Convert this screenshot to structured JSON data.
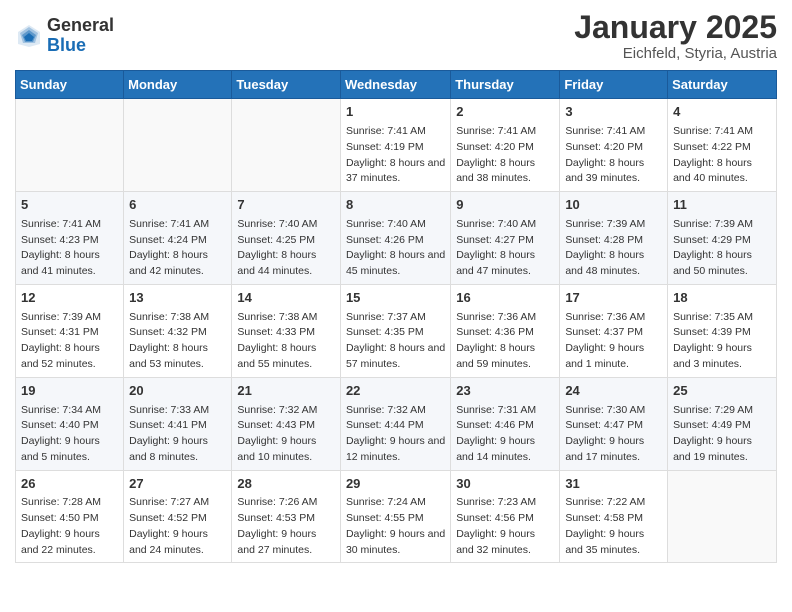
{
  "header": {
    "logo_line1": "General",
    "logo_line2": "Blue",
    "title": "January 2025",
    "location": "Eichfeld, Styria, Austria"
  },
  "weekdays": [
    "Sunday",
    "Monday",
    "Tuesday",
    "Wednesday",
    "Thursday",
    "Friday",
    "Saturday"
  ],
  "weeks": [
    [
      {
        "day": "",
        "content": ""
      },
      {
        "day": "",
        "content": ""
      },
      {
        "day": "",
        "content": ""
      },
      {
        "day": "1",
        "content": "Sunrise: 7:41 AM\nSunset: 4:19 PM\nDaylight: 8 hours and 37 minutes."
      },
      {
        "day": "2",
        "content": "Sunrise: 7:41 AM\nSunset: 4:20 PM\nDaylight: 8 hours and 38 minutes."
      },
      {
        "day": "3",
        "content": "Sunrise: 7:41 AM\nSunset: 4:20 PM\nDaylight: 8 hours and 39 minutes."
      },
      {
        "day": "4",
        "content": "Sunrise: 7:41 AM\nSunset: 4:22 PM\nDaylight: 8 hours and 40 minutes."
      }
    ],
    [
      {
        "day": "5",
        "content": "Sunrise: 7:41 AM\nSunset: 4:23 PM\nDaylight: 8 hours and 41 minutes."
      },
      {
        "day": "6",
        "content": "Sunrise: 7:41 AM\nSunset: 4:24 PM\nDaylight: 8 hours and 42 minutes."
      },
      {
        "day": "7",
        "content": "Sunrise: 7:40 AM\nSunset: 4:25 PM\nDaylight: 8 hours and 44 minutes."
      },
      {
        "day": "8",
        "content": "Sunrise: 7:40 AM\nSunset: 4:26 PM\nDaylight: 8 hours and 45 minutes."
      },
      {
        "day": "9",
        "content": "Sunrise: 7:40 AM\nSunset: 4:27 PM\nDaylight: 8 hours and 47 minutes."
      },
      {
        "day": "10",
        "content": "Sunrise: 7:39 AM\nSunset: 4:28 PM\nDaylight: 8 hours and 48 minutes."
      },
      {
        "day": "11",
        "content": "Sunrise: 7:39 AM\nSunset: 4:29 PM\nDaylight: 8 hours and 50 minutes."
      }
    ],
    [
      {
        "day": "12",
        "content": "Sunrise: 7:39 AM\nSunset: 4:31 PM\nDaylight: 8 hours and 52 minutes."
      },
      {
        "day": "13",
        "content": "Sunrise: 7:38 AM\nSunset: 4:32 PM\nDaylight: 8 hours and 53 minutes."
      },
      {
        "day": "14",
        "content": "Sunrise: 7:38 AM\nSunset: 4:33 PM\nDaylight: 8 hours and 55 minutes."
      },
      {
        "day": "15",
        "content": "Sunrise: 7:37 AM\nSunset: 4:35 PM\nDaylight: 8 hours and 57 minutes."
      },
      {
        "day": "16",
        "content": "Sunrise: 7:36 AM\nSunset: 4:36 PM\nDaylight: 8 hours and 59 minutes."
      },
      {
        "day": "17",
        "content": "Sunrise: 7:36 AM\nSunset: 4:37 PM\nDaylight: 9 hours and 1 minute."
      },
      {
        "day": "18",
        "content": "Sunrise: 7:35 AM\nSunset: 4:39 PM\nDaylight: 9 hours and 3 minutes."
      }
    ],
    [
      {
        "day": "19",
        "content": "Sunrise: 7:34 AM\nSunset: 4:40 PM\nDaylight: 9 hours and 5 minutes."
      },
      {
        "day": "20",
        "content": "Sunrise: 7:33 AM\nSunset: 4:41 PM\nDaylight: 9 hours and 8 minutes."
      },
      {
        "day": "21",
        "content": "Sunrise: 7:32 AM\nSunset: 4:43 PM\nDaylight: 9 hours and 10 minutes."
      },
      {
        "day": "22",
        "content": "Sunrise: 7:32 AM\nSunset: 4:44 PM\nDaylight: 9 hours and 12 minutes."
      },
      {
        "day": "23",
        "content": "Sunrise: 7:31 AM\nSunset: 4:46 PM\nDaylight: 9 hours and 14 minutes."
      },
      {
        "day": "24",
        "content": "Sunrise: 7:30 AM\nSunset: 4:47 PM\nDaylight: 9 hours and 17 minutes."
      },
      {
        "day": "25",
        "content": "Sunrise: 7:29 AM\nSunset: 4:49 PM\nDaylight: 9 hours and 19 minutes."
      }
    ],
    [
      {
        "day": "26",
        "content": "Sunrise: 7:28 AM\nSunset: 4:50 PM\nDaylight: 9 hours and 22 minutes."
      },
      {
        "day": "27",
        "content": "Sunrise: 7:27 AM\nSunset: 4:52 PM\nDaylight: 9 hours and 24 minutes."
      },
      {
        "day": "28",
        "content": "Sunrise: 7:26 AM\nSunset: 4:53 PM\nDaylight: 9 hours and 27 minutes."
      },
      {
        "day": "29",
        "content": "Sunrise: 7:24 AM\nSunset: 4:55 PM\nDaylight: 9 hours and 30 minutes."
      },
      {
        "day": "30",
        "content": "Sunrise: 7:23 AM\nSunset: 4:56 PM\nDaylight: 9 hours and 32 minutes."
      },
      {
        "day": "31",
        "content": "Sunrise: 7:22 AM\nSunset: 4:58 PM\nDaylight: 9 hours and 35 minutes."
      },
      {
        "day": "",
        "content": ""
      }
    ]
  ]
}
